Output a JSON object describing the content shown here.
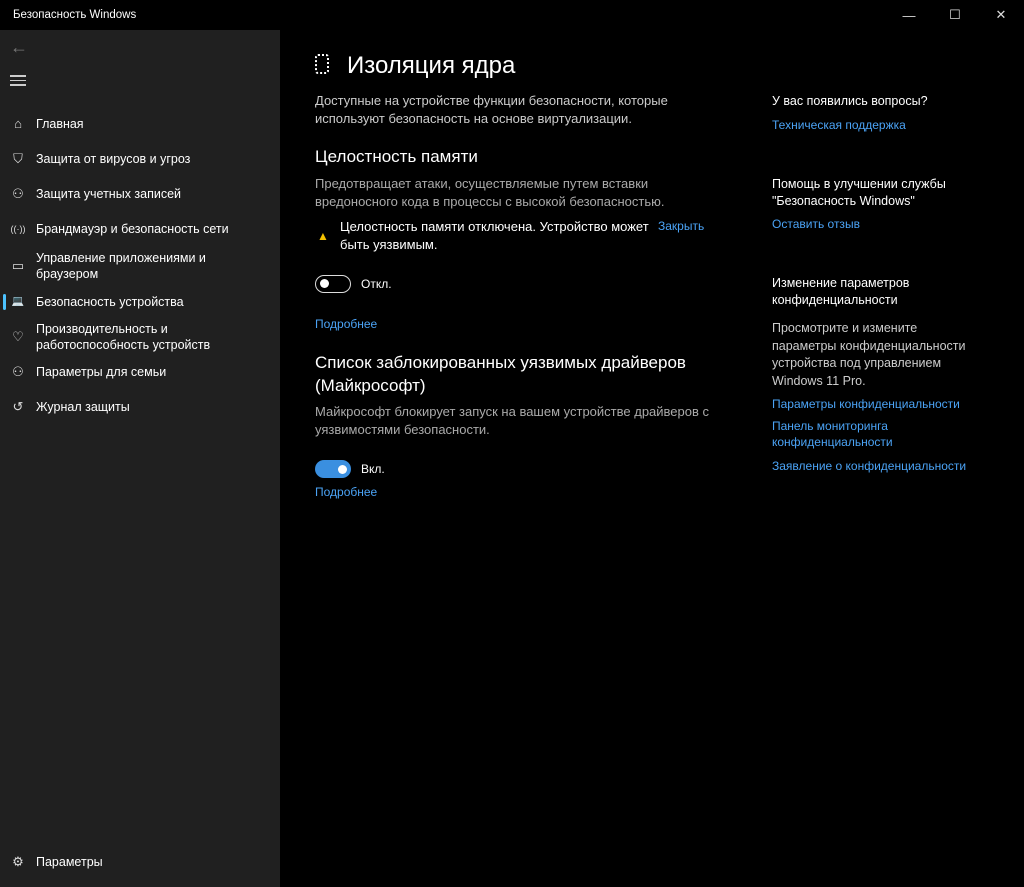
{
  "window": {
    "title": "Безопасность Windows",
    "minimize": "—",
    "maximize": "☐",
    "close": "✕"
  },
  "sidebar": {
    "back": "←",
    "items": [
      {
        "label": "Главная",
        "icon": "⌂"
      },
      {
        "label": "Защита от вирусов и угроз",
        "icon": "⛉"
      },
      {
        "label": "Защита учетных записей",
        "icon": "⚇"
      },
      {
        "label": "Брандмауэр и безопасность сети",
        "icon": "((·))"
      },
      {
        "label": "Управление приложениями и браузером",
        "icon": "▭"
      },
      {
        "label": "Безопасность устройства",
        "icon": "💻"
      },
      {
        "label": "Производительность и работоспособность устройств",
        "icon": "♡"
      },
      {
        "label": "Параметры для семьи",
        "icon": "⚇"
      },
      {
        "label": "Журнал защиты",
        "icon": "↺"
      }
    ],
    "settings": {
      "label": "Параметры",
      "icon": "⚙"
    }
  },
  "main": {
    "title": "Изоляция ядра",
    "description": "Доступные на устройстве функции безопасности, которые используют безопасность на основе виртуализации.",
    "memory": {
      "heading": "Целостность памяти",
      "description": "Предотвращает атаки, осуществляемые путем вставки вредоносного кода в процессы с высокой безопасностью.",
      "warning": "Целостность памяти отключена. Устройство может быть уязвимым.",
      "dismiss": "Закрыть",
      "toggle_label": "Откл.",
      "toggle_on": false,
      "more": "Подробнее"
    },
    "drivers": {
      "heading": "Список заблокированных уязвимых драйверов (Майкрософт)",
      "description": "Майкрософт блокирует запуск на вашем устройстве драйверов с уязвимостями безопасности.",
      "toggle_label": "Вкл.",
      "toggle_on": true,
      "more": "Подробнее"
    }
  },
  "right": {
    "questions": {
      "heading": "У вас появились вопросы?",
      "link": "Техническая поддержка"
    },
    "feedback": {
      "heading": "Помощь в улучшении службы \"Безопасность Windows\"",
      "link": "Оставить отзыв"
    },
    "privacy": {
      "heading": "Изменение параметров конфиденциальности",
      "text": "Просмотрите и измените параметры конфиденциальности устройства под управлением Windows 11 Pro.",
      "links": [
        "Параметры конфиденциальности",
        "Панель мониторинга конфиденциальности",
        "Заявление о конфиденциальности"
      ]
    }
  }
}
